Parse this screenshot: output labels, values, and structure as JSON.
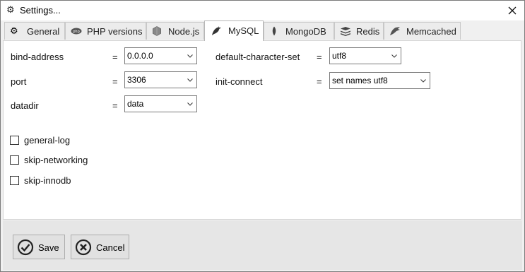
{
  "window": {
    "title": "Settings..."
  },
  "tabs": [
    {
      "label": "General",
      "icon": "gear-icon",
      "active": false
    },
    {
      "label": "PHP versions",
      "icon": "php-icon",
      "active": false
    },
    {
      "label": "Node.js",
      "icon": "nodejs-icon",
      "active": false
    },
    {
      "label": "MySQL",
      "icon": "mysql-dolphin-icon",
      "active": true
    },
    {
      "label": "MongoDB",
      "icon": "mongodb-leaf-icon",
      "active": false
    },
    {
      "label": "Redis",
      "icon": "redis-icon",
      "active": false
    },
    {
      "label": "Memcached",
      "icon": "memcached-icon",
      "active": false
    }
  ],
  "settings": {
    "equals": "=",
    "bind_address": {
      "label": "bind-address",
      "value": "0.0.0.0"
    },
    "port": {
      "label": "port",
      "value": "3306"
    },
    "datadir": {
      "label": "datadir",
      "value": "data"
    },
    "default_character_set": {
      "label": "default-character-set",
      "value": "utf8"
    },
    "init_connect": {
      "label": "init-connect",
      "value": "set names utf8"
    }
  },
  "checkboxes": [
    {
      "label": "general-log",
      "checked": false
    },
    {
      "label": "skip-networking",
      "checked": false
    },
    {
      "label": "skip-innodb",
      "checked": false
    }
  ],
  "buttons": {
    "save": {
      "label": "Save",
      "icon": "check-circle-icon"
    },
    "cancel": {
      "label": "Cancel",
      "icon": "cancel-x-icon"
    }
  }
}
